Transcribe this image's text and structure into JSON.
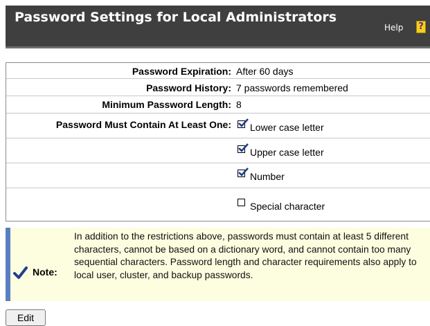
{
  "header": {
    "title": "Password Settings for Local Administrators",
    "help_label": "Help",
    "help_icon": "question-book-icon"
  },
  "settings": {
    "expiration": {
      "label": "Password Expiration:",
      "value": "After 60 days"
    },
    "history": {
      "label": "Password History:",
      "value": "7 passwords remembered"
    },
    "min_length": {
      "label": "Minimum Password Length:",
      "value": "8"
    },
    "must_contain": {
      "label": "Password Must Contain At Least One:",
      "options": [
        {
          "label": "Lower case letter",
          "checked": true
        },
        {
          "label": "Upper case letter",
          "checked": true
        },
        {
          "label": "Number",
          "checked": true
        },
        {
          "label": "Special character",
          "checked": false
        }
      ]
    }
  },
  "note": {
    "label": "Note:",
    "text": "In addition to the restrictions above, passwords must contain at least 5 different characters, cannot be based on a dictionary word, and cannot contain too many sequential characters. Password length and character requirements also apply to local user, cluster, and backup passwords.",
    "icon": "checkmark-icon"
  },
  "actions": {
    "edit_label": "Edit"
  },
  "colors": {
    "header_bg": "#3f3f3f",
    "note_bg": "#fdfde0",
    "note_stripe": "#5a7ec2",
    "checkmark": "#1f3f8c"
  }
}
